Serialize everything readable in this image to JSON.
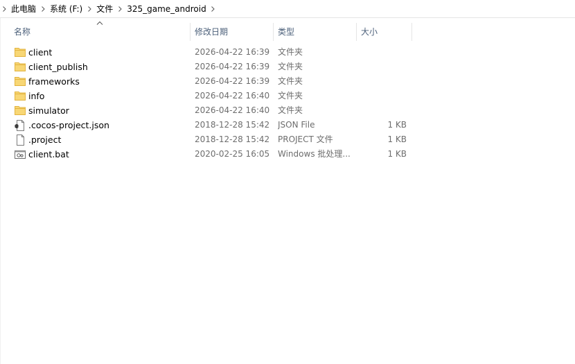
{
  "breadcrumb": {
    "items": [
      {
        "label": "此电脑"
      },
      {
        "label": "系统 (F:)"
      },
      {
        "label": "文件"
      },
      {
        "label": "325_game_android"
      }
    ]
  },
  "columns": {
    "name": "名称",
    "date": "修改日期",
    "type": "类型",
    "size": "大小",
    "sorted_by": "name",
    "sort_direction": "ascending"
  },
  "files": [
    {
      "name": "client",
      "modified": "2026-04-22 16:39",
      "type": "文件夹",
      "size": "",
      "icon": "folder-icon"
    },
    {
      "name": "client_publish",
      "modified": "2026-04-22 16:39",
      "type": "文件夹",
      "size": "",
      "icon": "folder-icon"
    },
    {
      "name": "frameworks",
      "modified": "2026-04-22 16:39",
      "type": "文件夹",
      "size": "",
      "icon": "folder-icon"
    },
    {
      "name": "info",
      "modified": "2026-04-22 16:40",
      "type": "文件夹",
      "size": "",
      "icon": "folder-icon"
    },
    {
      "name": "simulator",
      "modified": "2026-04-22 16:40",
      "type": "文件夹",
      "size": "",
      "icon": "folder-icon"
    },
    {
      "name": ".cocos-project.json",
      "modified": "2018-12-28 15:42",
      "type": "JSON File",
      "size": "1 KB",
      "icon": "json-file-icon"
    },
    {
      "name": ".project",
      "modified": "2018-12-28 15:42",
      "type": "PROJECT 文件",
      "size": "1 KB",
      "icon": "blank-file-icon"
    },
    {
      "name": "client.bat",
      "modified": "2020-02-25 16:05",
      "type": "Windows 批处理...",
      "size": "1 KB",
      "icon": "batch-file-icon"
    }
  ],
  "colors": {
    "folder": "#f8d775",
    "folder_dark": "#e2b33f",
    "header_text": "#4c607a",
    "meta_text": "#6d6d6d",
    "divider": "#e5e5e5"
  }
}
